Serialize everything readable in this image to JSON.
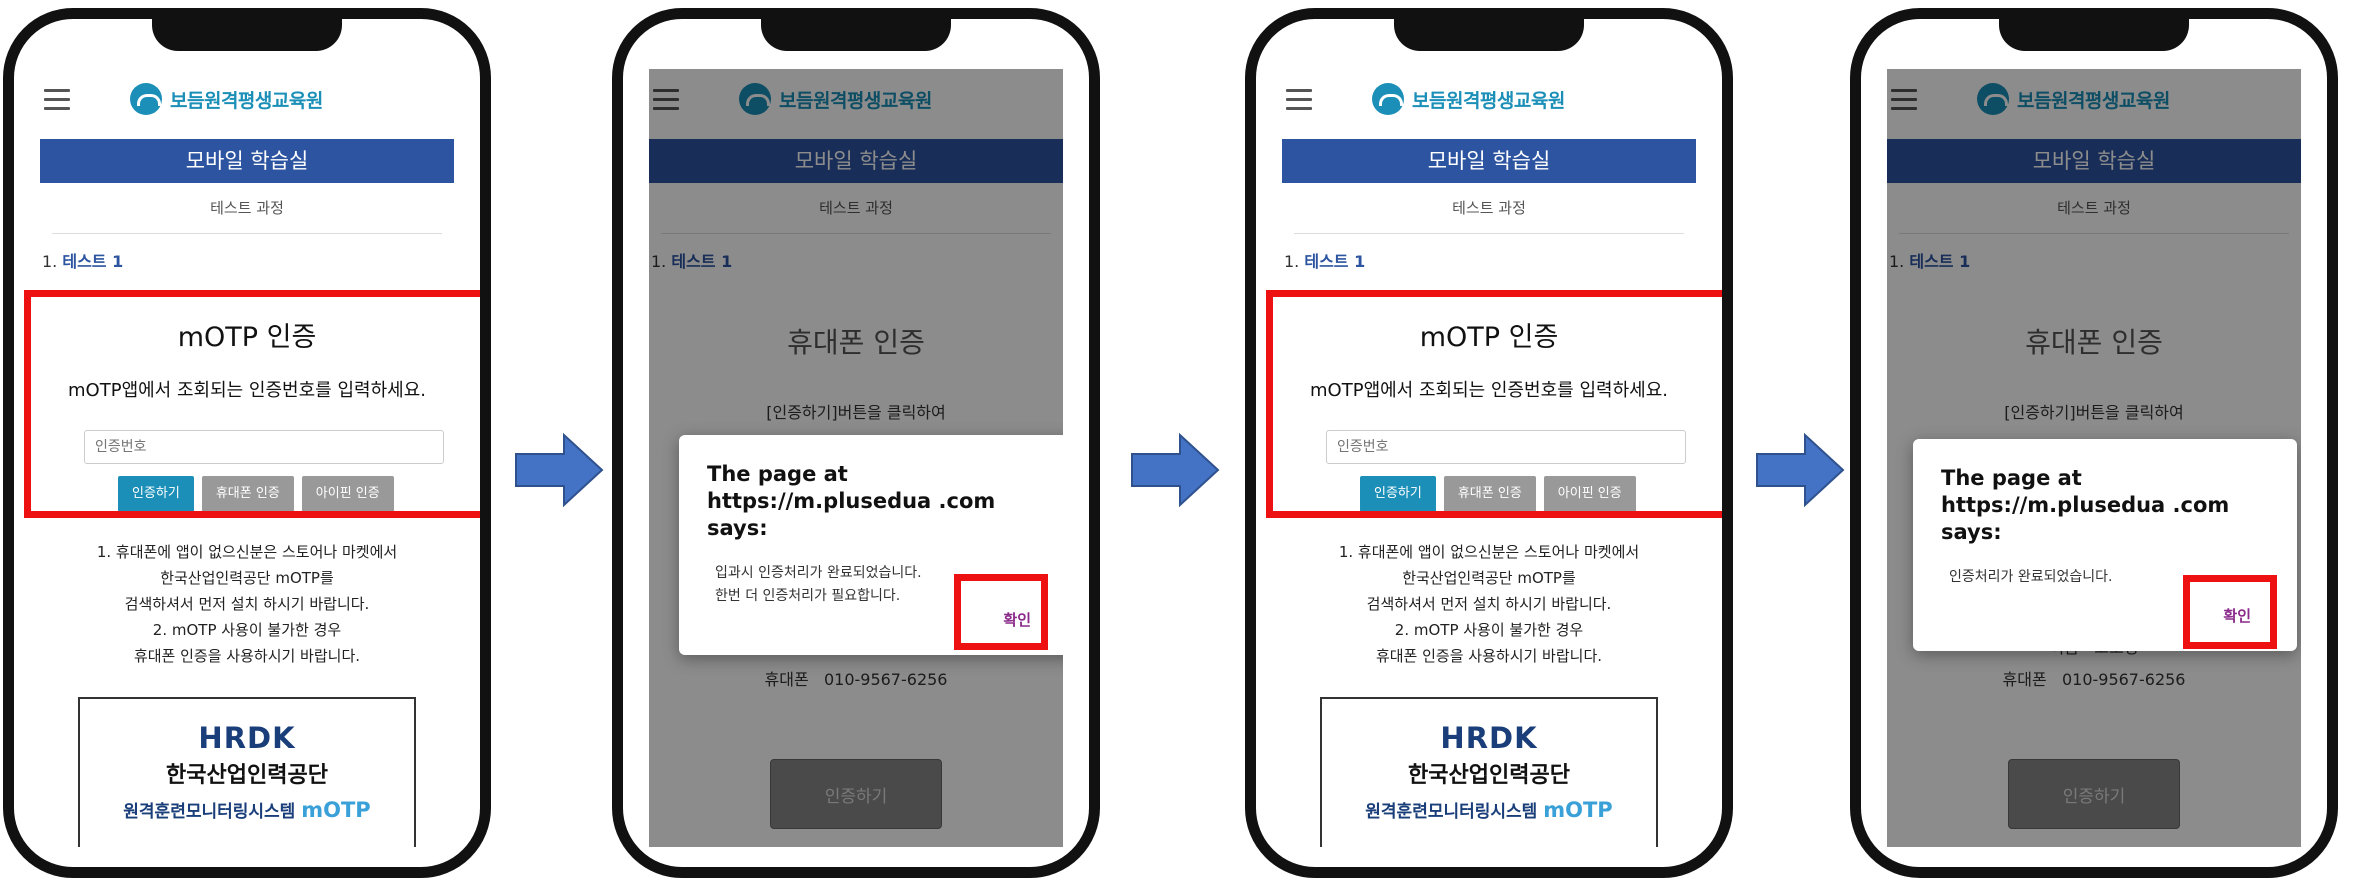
{
  "common": {
    "brand": "보듬원격평생교육원",
    "bar": "모바일 학습실",
    "course": "테스트 과정",
    "lesson_num": "1.",
    "lesson_name": "테스트 1"
  },
  "otp": {
    "title": "mOTP 인증",
    "desc": "mOTP앱에서 조회되는 인증번호를 입력하세요.",
    "placeholder": "인증번호",
    "btn_auth": "인증하기",
    "btn_phone": "휴대폰 인증",
    "btn_ipin": "아이핀 인증"
  },
  "notes": [
    "1. 휴대폰에 앱이 없으신분은 스토어나 마켓에서",
    "한국산업인력공단 mOTP를",
    "검색하셔서 먼저 설치 하시기 바랍니다.",
    "2. mOTP 사용이 불가한 경우",
    "휴대폰 인증을 사용하시기 바랍니다."
  ],
  "hrdk": {
    "logo": "HRDK",
    "name": "한국산업인력공단",
    "system": "원격훈련모니터링시스템",
    "system_brand": "mOTP"
  },
  "phone_auth": {
    "title": "휴대폰 인증",
    "desc": "[인증하기]버튼을 클릭하여",
    "name_label": "이름",
    "name_value": "고소영",
    "phone_label": "휴대폰",
    "phone_value": "010-9567-6256",
    "button": "인증하기"
  },
  "dialog1": {
    "title": "The page at https://m.plusedua .com says:",
    "msg1": "입과시 인증처리가 완료되었습니다.",
    "msg2": "한번 더 인증처리가 필요합니다.",
    "ok": "확인"
  },
  "dialog2": {
    "title": "The page at https://m.plusedua .com says:",
    "msg1": "인증처리가 완료되었습니다.",
    "ok": "확인"
  },
  "colors": {
    "highlight": "#ee1111",
    "arrow": "#4472c4",
    "bar": "#2c54a0",
    "brand": "#1b8fb8"
  }
}
